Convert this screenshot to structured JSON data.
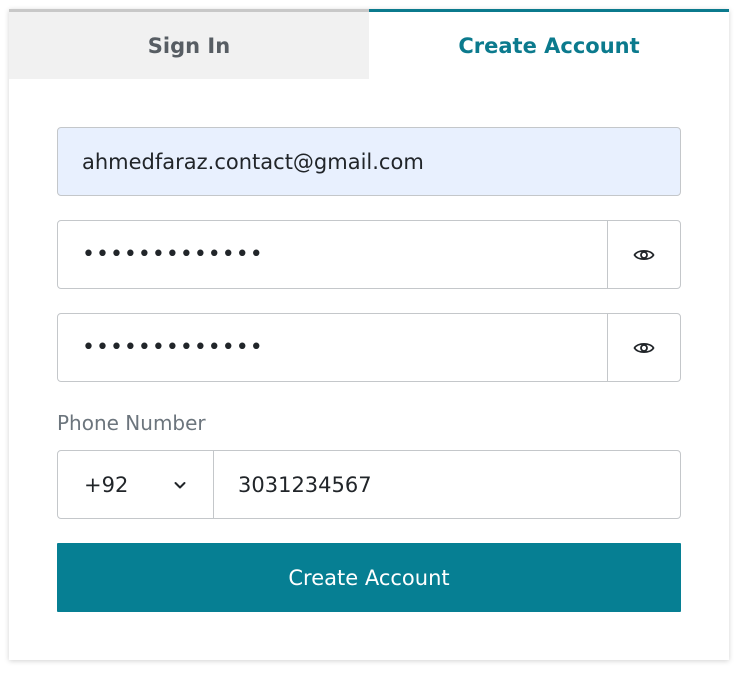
{
  "tabs": {
    "sign_in": "Sign In",
    "create_account": "Create Account",
    "active": "create_account"
  },
  "form": {
    "email": {
      "value": "ahmedfaraz.contact@gmail.com"
    },
    "password": {
      "masked_value": "•••••••••••••",
      "toggle_icon": "eye-icon"
    },
    "confirm_password": {
      "masked_value": "•••••••••••••",
      "toggle_icon": "eye-icon"
    },
    "phone": {
      "label": "Phone Number",
      "country_code": "+92",
      "number": "3031234567"
    },
    "submit_label": "Create Account"
  },
  "colors": {
    "accent": "#067f93",
    "active_tab_text": "#0b7a8d",
    "inactive_tab_bg": "#f1f1f1",
    "autofill_bg": "#e8f0fe"
  }
}
